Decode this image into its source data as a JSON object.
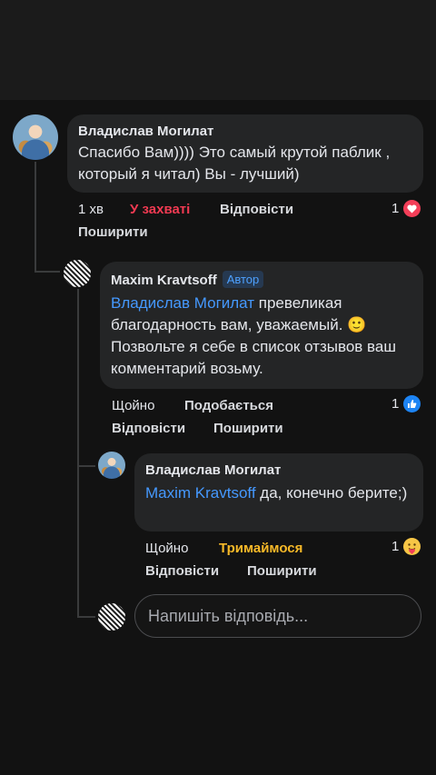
{
  "comments": [
    {
      "author": "Владислав Могилат",
      "text": "Спасибо Вам)))) Это самый крутой паблик , который я читал) Вы - лучший)",
      "time": "1 хв",
      "reaction_action": "У захваті",
      "reply": "Відповісти",
      "share": "Поширити",
      "reaction_count": "1",
      "reaction_icon": "heart-icon"
    },
    {
      "author": "Maxim Kravtsoff",
      "badge": "Автор",
      "mention": "Владислав Могилат",
      "text": " превеликая благодарность вам, уважаемый. 🙂 Позвольте я себе в список отзывов ваш комментарий возьму.",
      "time": "Щойно",
      "reaction_action": "Подобається",
      "reply": "Відповісти",
      "share": "Поширити",
      "reaction_count": "1",
      "reaction_icon": "like-icon"
    },
    {
      "author": "Владислав Могилат",
      "mention": "Maxim Kravtsoff",
      "text": " да, конечно берите;)",
      "time": "Щойно",
      "reaction_action": "Тримаймося",
      "reply": "Відповісти",
      "share": "Поширити",
      "reaction_count": "1",
      "reaction_icon": "care-icon"
    }
  ],
  "reply_input": {
    "placeholder": "Напишіть відповідь..."
  },
  "colors": {
    "background": "#121212",
    "bubble": "#242526",
    "mention": "#4599ff",
    "love": "#f23a52",
    "care": "#f7b928"
  }
}
